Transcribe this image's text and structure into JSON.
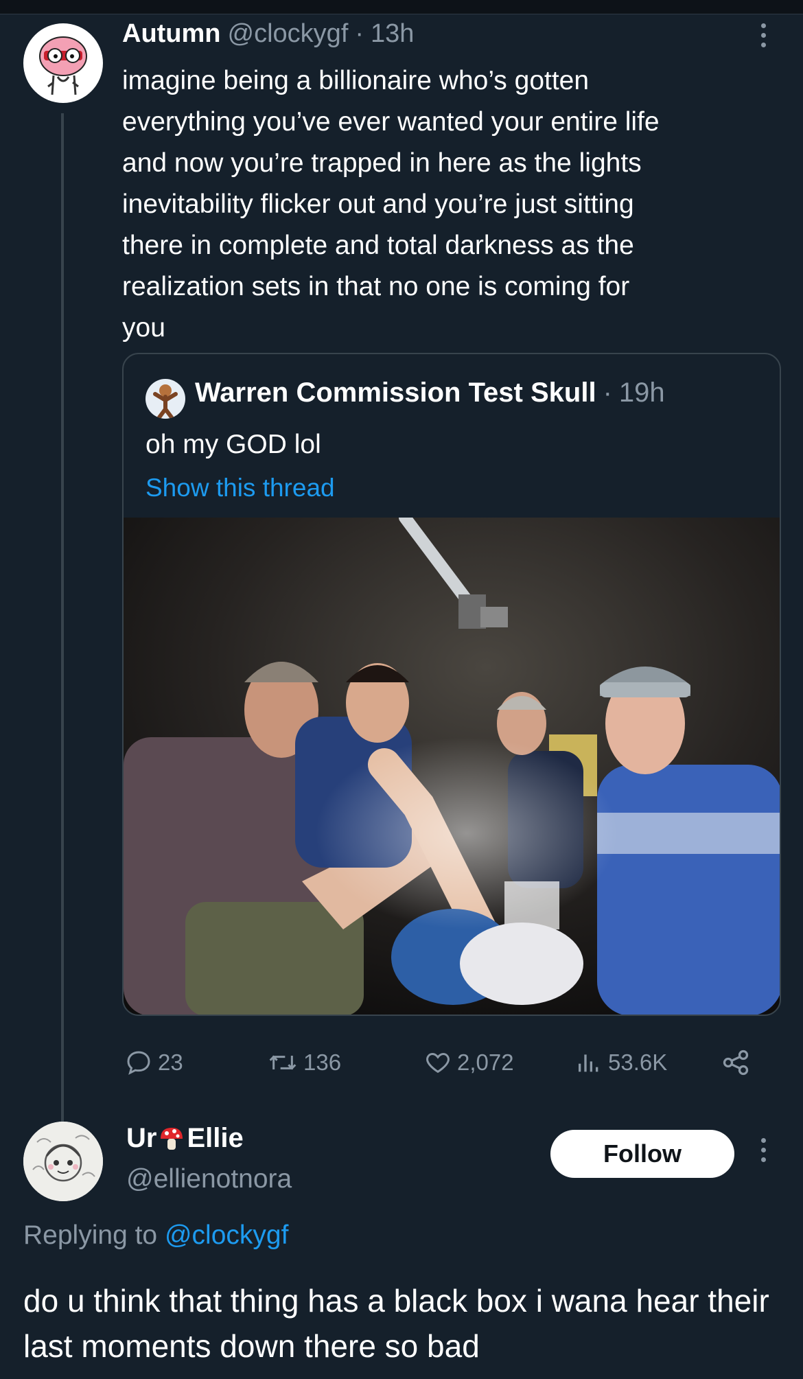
{
  "tweet": {
    "author_name": "Autumn",
    "author_handle": "@clockygf",
    "separator": "·",
    "time": "13h",
    "text": "imagine being a billionaire who’s gotten\neverything you’ve ever wanted your entire life\nand now you’re trapped in here as the lights\ninevitability flicker out and you’re just sitting\nthere in complete and total darkness as the\nrealization sets in that no one is coming for\nyou",
    "quote": {
      "author_name": "Warren Commission Test Skull",
      "separator": "·",
      "time": "19h",
      "text": "oh my GOD lol",
      "show_thread": "Show this thread"
    },
    "actions": {
      "replies": "23",
      "retweets": "136",
      "likes": "2,072",
      "views": "53.6K"
    }
  },
  "reply": {
    "author_name_prefix": "Ur",
    "author_name_emoji": "mushroom-emoji",
    "author_name_suffix": "Ellie",
    "author_handle": "@ellienotnora",
    "follow_label": "Follow",
    "replying_prefix": "Replying to",
    "replying_to": "@clockygf",
    "text": "do u think that thing has a black box i wana hear their last moments down there so bad"
  },
  "colors": {
    "background": "#15202b",
    "text": "#ffffff",
    "muted": "#8b98a5",
    "link": "#1d9bf0",
    "border": "#38444d"
  }
}
